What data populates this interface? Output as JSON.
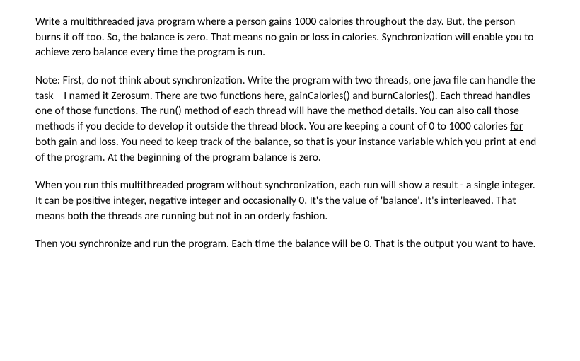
{
  "paragraphs": {
    "p1": "Write a multithreaded java program where a person gains 1000 calories throughout the day. But, the person burns it off too. So, the balance is zero. That means no gain or loss in calories. Synchronization will enable you to achieve zero balance every time the program is run.",
    "p2_part1": "Note: First, do not think about synchronization. Write the program with two threads, one java file can handle the task – I named it Zerosum. There are two functions here, gainCalories() and burnCalories(). Each thread handles one of those functions. The run() method of each thread will have the method details. You can also call those methods if you decide to develop it outside the thread block. You are keeping a count of 0 to 1000 calories ",
    "p2_underline": "for",
    "p2_part2": " both gain and loss. You need to keep track of the balance, so that is your instance variable which you print at end of the program. At the beginning of the program balance is zero.",
    "p3": "When you run this multithreaded program without synchronization, each run will show a result - a single integer. It can be positive integer, negative integer and occasionally 0. It's the value of 'balance'. It's interleaved. That means both the threads are running but not in an orderly fashion.",
    "p4": "Then you synchronize and run the program. Each time the balance will be 0. That is the output you want to have."
  }
}
